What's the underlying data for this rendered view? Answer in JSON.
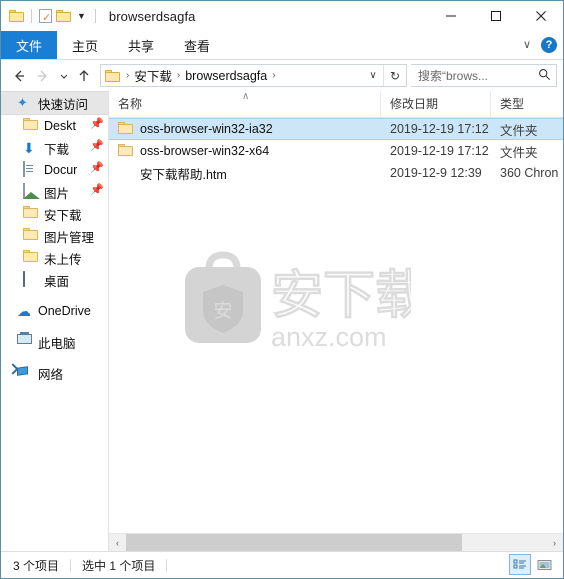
{
  "window": {
    "title": "browserdsagfa",
    "quick_access_toolbar": [
      {
        "name": "folder-icon",
        "label": ""
      },
      {
        "name": "properties-icon",
        "label": ""
      },
      {
        "name": "new-folder-icon",
        "label": ""
      }
    ],
    "controls": {
      "minimize": "—",
      "maximize": "□",
      "close": "✕"
    }
  },
  "ribbon": {
    "tabs": [
      {
        "label": "文件",
        "active": true
      },
      {
        "label": "主页",
        "active": false
      },
      {
        "label": "共享",
        "active": false
      },
      {
        "label": "查看",
        "active": false
      }
    ],
    "expand_caret": "∨",
    "help_label": "?"
  },
  "address": {
    "back": "←",
    "forward": "→",
    "history_caret": "∨",
    "up": "↑",
    "breadcrumbs": [
      {
        "label": "",
        "icon": "folder-icon"
      },
      {
        "label": "安下载"
      },
      {
        "label": "browserdsagfa"
      }
    ],
    "separator": "›",
    "dropdown_caret": "∨",
    "refresh": "↻"
  },
  "search": {
    "value": "搜索“brows...",
    "icon": "search-icon"
  },
  "sidebar": {
    "items": [
      {
        "label": "快速访问",
        "icon": "star-icon",
        "level": 0,
        "selected": true,
        "pinned": false
      },
      {
        "label": "Deskt",
        "icon": "folder-icon",
        "level": 1,
        "selected": false,
        "pinned": true
      },
      {
        "label": "下载",
        "icon": "download-icon",
        "level": 1,
        "selected": false,
        "pinned": true
      },
      {
        "label": "Docur",
        "icon": "document-icon",
        "level": 1,
        "selected": false,
        "pinned": true
      },
      {
        "label": "图片",
        "icon": "picture-icon",
        "level": 1,
        "selected": false,
        "pinned": true
      },
      {
        "label": "安下载",
        "icon": "folder-icon",
        "level": 1,
        "selected": false,
        "pinned": false
      },
      {
        "label": "图片管理",
        "icon": "folder-icon",
        "level": 1,
        "selected": false,
        "pinned": false
      },
      {
        "label": "未上传",
        "icon": "folder-icon",
        "level": 1,
        "selected": false,
        "pinned": false
      },
      {
        "label": "桌面",
        "icon": "monitor-icon",
        "level": 1,
        "selected": false,
        "pinned": false
      },
      {
        "label": "OneDrive",
        "icon": "cloud-icon",
        "level": 0,
        "selected": false,
        "pinned": false
      },
      {
        "label": "此电脑",
        "icon": "pc-icon",
        "level": 0,
        "selected": false,
        "pinned": false
      },
      {
        "label": "网络",
        "icon": "network-icon",
        "level": 0,
        "selected": false,
        "pinned": false
      }
    ],
    "pin_glyph": "✒"
  },
  "filelist": {
    "columns": [
      {
        "label": "名称",
        "key": "name"
      },
      {
        "label": "修改日期",
        "key": "date"
      },
      {
        "label": "类型",
        "key": "type"
      }
    ],
    "sort_caret": "∧",
    "rows": [
      {
        "name": "oss-browser-win32-ia32",
        "date": "2019-12-19 17:12",
        "type": "文件夹",
        "icon": "folder-icon",
        "selected": true
      },
      {
        "name": "oss-browser-win32-x64",
        "date": "2019-12-19 17:12",
        "type": "文件夹",
        "icon": "folder-icon",
        "selected": false
      },
      {
        "name": "安下载帮助.htm",
        "date": "2019-12-9 12:39",
        "type": "360 Chron",
        "icon": "chrome-360-icon",
        "selected": false
      }
    ]
  },
  "watermark": {
    "shield_text": "安",
    "brand_text": "安下载",
    "domain_text": "anxz.com"
  },
  "scrollbar": {
    "left_arrow": "‹",
    "right_arrow": "›",
    "thumb_percent": 80
  },
  "statusbar": {
    "item_count": "3 个项目",
    "selection": "选中 1 个项目",
    "views": [
      {
        "name": "details-view-button",
        "active": true
      },
      {
        "name": "large-icons-view-button",
        "active": false
      }
    ]
  },
  "colors": {
    "accent": "#1a7fd4",
    "selection": "#cce6f7",
    "window_border": "#5a8fa8"
  }
}
